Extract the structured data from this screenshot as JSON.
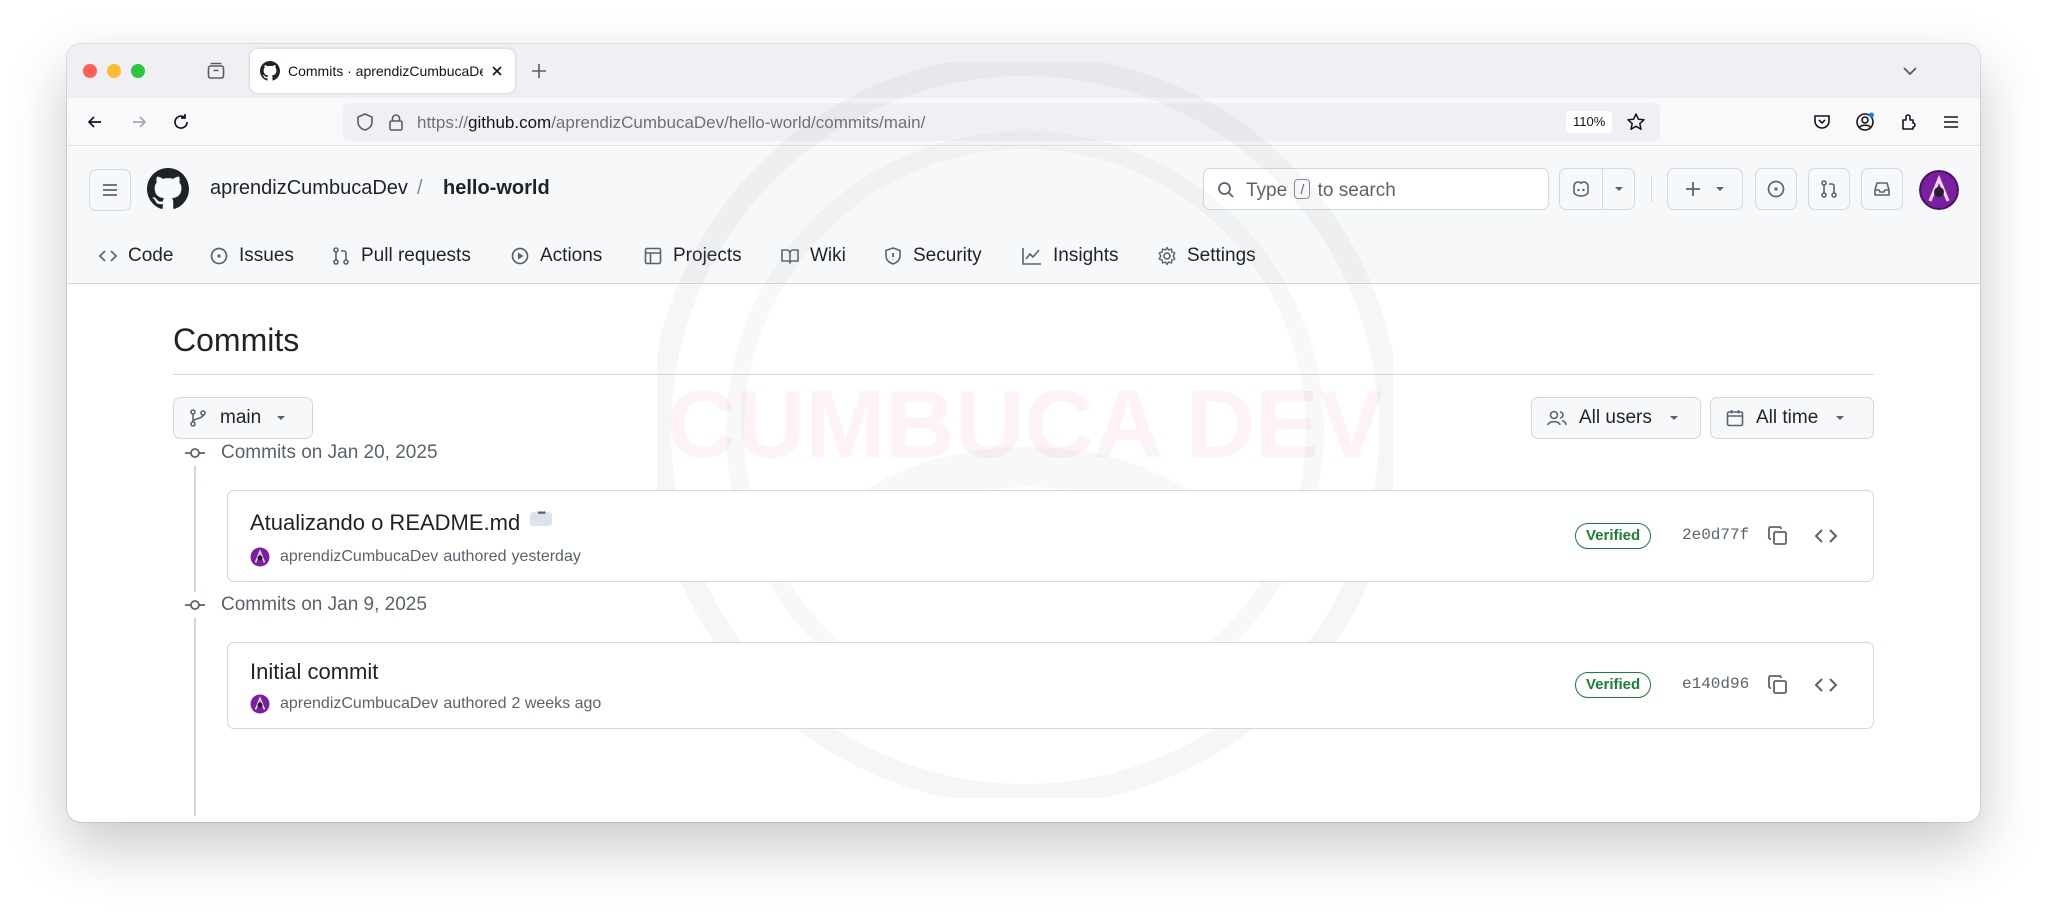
{
  "browser": {
    "tab_title": "Commits · aprendizCumbucaDev/hello-world",
    "url_scheme": "https://",
    "url_host": "github.com",
    "url_path": "/aprendizCumbucaDev/hello-world/commits/main/",
    "zoom": "110%"
  },
  "header": {
    "owner": "aprendizCumbucaDev",
    "separator": "/",
    "repo": "hello-world",
    "search_prefix": "Type",
    "search_key": "/",
    "search_suffix": "to search"
  },
  "repo_nav": [
    {
      "label": "Code",
      "icon": "code-icon"
    },
    {
      "label": "Issues",
      "icon": "issue-icon"
    },
    {
      "label": "Pull requests",
      "icon": "pull-request-icon"
    },
    {
      "label": "Actions",
      "icon": "play-icon"
    },
    {
      "label": "Projects",
      "icon": "table-icon"
    },
    {
      "label": "Wiki",
      "icon": "book-icon"
    },
    {
      "label": "Security",
      "icon": "shield-icon"
    },
    {
      "label": "Insights",
      "icon": "graph-icon"
    },
    {
      "label": "Settings",
      "icon": "gear-icon"
    }
  ],
  "page": {
    "title": "Commits",
    "branch": "main",
    "users_filter": "All users",
    "time_filter": "All time"
  },
  "watermark_text": "CUMBUCA DEV",
  "commit_groups": [
    {
      "heading": "Commits on Jan 20, 2025",
      "commits": [
        {
          "title": "Atualizando o README.md",
          "author": "aprendizCumbucaDev",
          "action": "authored",
          "time": "yesterday",
          "badge": "Verified",
          "sha": "2e0d77f",
          "has_ellipsis": true
        }
      ]
    },
    {
      "heading": "Commits on Jan 9, 2025",
      "commits": [
        {
          "title": "Initial commit",
          "author": "aprendizCumbucaDev",
          "action": "authored",
          "time": "2 weeks ago",
          "badge": "Verified",
          "sha": "e140d96",
          "has_ellipsis": false
        }
      ]
    }
  ],
  "colors": {
    "verified": "#1a7f37",
    "avatar": "#7b1fa2",
    "watermark": "#d81b60"
  }
}
